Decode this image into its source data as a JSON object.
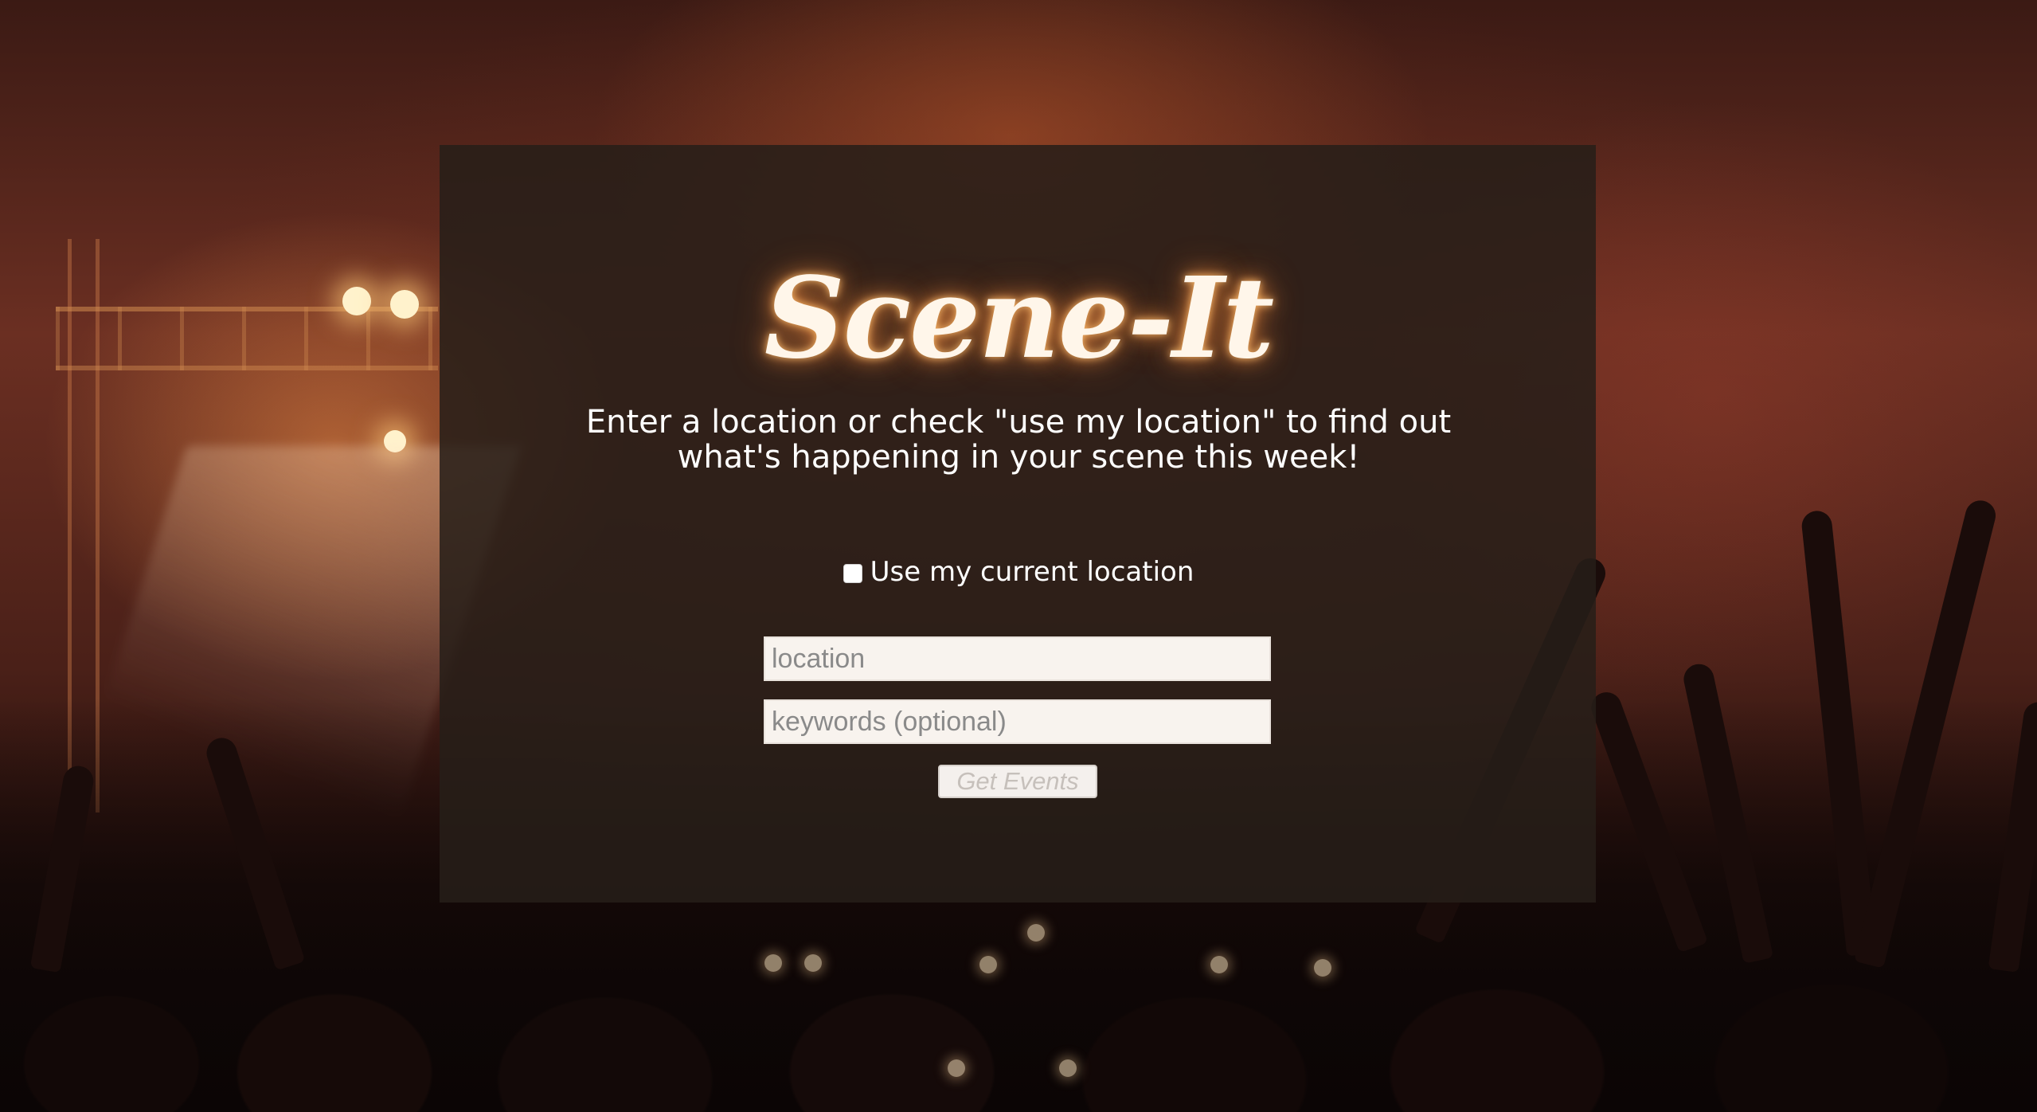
{
  "app": {
    "title": "Scene-It",
    "tagline_line1": "Enter a location or check \"use my location\" to find out",
    "tagline_line2": "what's happening in your scene this week!"
  },
  "form": {
    "use_location_label": "Use my current location",
    "use_location_checked": false,
    "location": {
      "placeholder": "location",
      "value": ""
    },
    "keywords": {
      "placeholder": "keywords (optional)",
      "value": ""
    },
    "submit_label": "Get Events"
  },
  "colors": {
    "panel": "#261e18",
    "title_glow": "#ff9646",
    "text": "#ffffff"
  }
}
